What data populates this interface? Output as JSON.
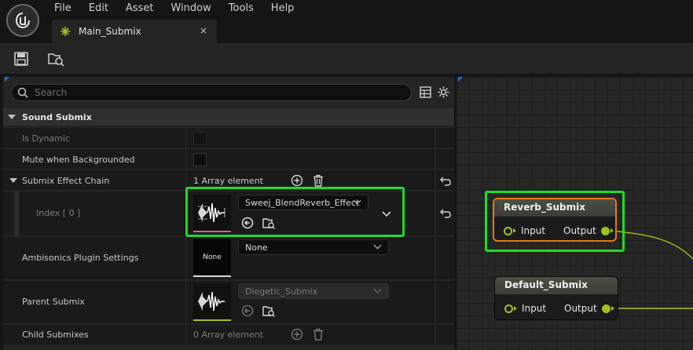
{
  "menu": [
    "File",
    "Edit",
    "Asset",
    "Window",
    "Tools",
    "Help"
  ],
  "tab": {
    "label": "Main_Submix",
    "close": "×"
  },
  "search": {
    "placeholder": "Search"
  },
  "category": {
    "label": "Sound Submix"
  },
  "rows": {
    "is_dynamic": "Is Dynamic",
    "mute_bg": "Mute when Backgrounded",
    "effect_chain": "Submix Effect Chain",
    "effect_chain_value": "1 Array element",
    "index": "Index [ 0 ]",
    "index_value": "Sweej_BlendReverb_Effect",
    "ambisonics": "Ambisonics Plugin Settings",
    "ambisonics_thumb": "None",
    "ambisonics_value": "None",
    "parent": "Parent Submix",
    "parent_value": "Diegetic_Submix",
    "children": "Child Submixes",
    "children_value": "0 Array element"
  },
  "graph": {
    "nodes": [
      {
        "title": "Reverb_Submix",
        "input": "Input",
        "output": "Output",
        "selected": true
      },
      {
        "title": "Default_Submix",
        "input": "Input",
        "output": "Output",
        "selected": false
      }
    ]
  },
  "colors": {
    "highlight": "#1ddc2a",
    "pin": "#9ec21c",
    "accent_blue": "#1e6fd0",
    "selection_orange": "#e07b1a"
  }
}
